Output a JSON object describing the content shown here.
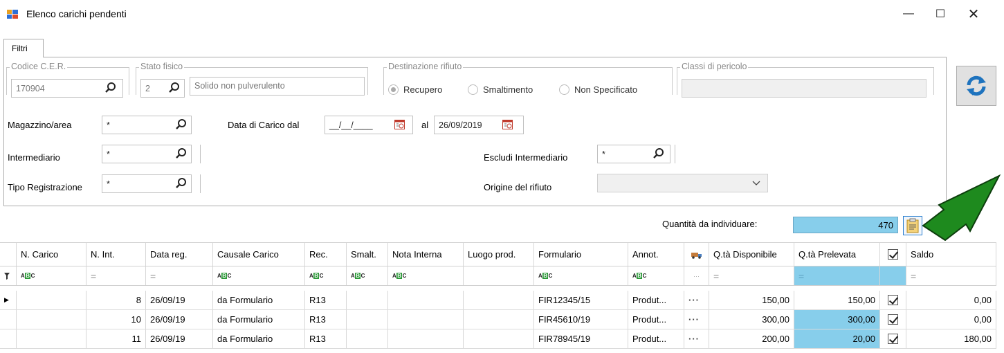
{
  "window": {
    "title": "Elenco carichi pendenti",
    "minimize": "—",
    "maximize": "☐",
    "close": "✕"
  },
  "tabs": [
    {
      "label": "Filtri"
    }
  ],
  "filters": {
    "cer": {
      "legend": "Codice C.E.R.",
      "value": "170904"
    },
    "stato_fisico": {
      "legend": "Stato fisico",
      "code": "2",
      "description": "Solido non pulverulento"
    },
    "destinazione": {
      "legend": "Destinazione rifiuto",
      "options": [
        "Recupero",
        "Smaltimento",
        "Non Specificato"
      ],
      "selected": "Recupero"
    },
    "classi_pericolo": {
      "legend": "Classi di pericolo",
      "value": ""
    },
    "magazzino": {
      "label": "Magazzino/area",
      "value": "*"
    },
    "data_carico": {
      "label": "Data di Carico dal",
      "from": "__/__/____",
      "al_label": "al",
      "to": "26/09/2019"
    },
    "intermediario": {
      "label": "Intermediario",
      "value": "*",
      "description": ""
    },
    "escludi_intermediario": {
      "label": "Escludi Intermediario",
      "value": "*",
      "description": ""
    },
    "tipo_registrazione": {
      "label": "Tipo Registrazione",
      "value": "*",
      "description": ""
    },
    "origine_rifiuto": {
      "label": "Origine del rifiuto",
      "value": ""
    }
  },
  "quantity": {
    "label": "Quantità da individuare:",
    "value": "470"
  },
  "grid": {
    "columns": [
      "N. Carico",
      "N. Int.",
      "Data reg.",
      "Causale Carico",
      "Rec.",
      "Smalt.",
      "Nota Interna",
      "Luogo prod.",
      "Formulario",
      "Annot.",
      "",
      "Q.tà Disponibile",
      "Q.tà Prelevata",
      "",
      "Saldo"
    ],
    "rows": [
      {
        "n_carico": "",
        "n_int": "8",
        "data": "26/09/19",
        "causale": "da Formulario",
        "rec": "R13",
        "smalt": "",
        "nota": "",
        "luogo": "",
        "formulario": "FIR12345/15",
        "annot": "Produt...",
        "more": "···",
        "disponibile": "150,00",
        "prelevata": "150,00",
        "checked": true,
        "saldo": "0,00"
      },
      {
        "n_carico": "",
        "n_int": "10",
        "data": "26/09/19",
        "causale": "da Formulario",
        "rec": "R13",
        "smalt": "",
        "nota": "",
        "luogo": "",
        "formulario": "FIR45610/19",
        "annot": "Produt...",
        "more": "···",
        "disponibile": "300,00",
        "prelevata": "300,00",
        "checked": true,
        "saldo": "0,00"
      },
      {
        "n_carico": "",
        "n_int": "11",
        "data": "26/09/19",
        "causale": "da Formulario",
        "rec": "R13",
        "smalt": "",
        "nota": "",
        "luogo": "",
        "formulario": "FIR78945/19",
        "annot": "Produt...",
        "more": "···",
        "disponibile": "200,00",
        "prelevata": "20,00",
        "checked": true,
        "saldo": "180,00"
      }
    ]
  },
  "colors": {
    "highlight": "#87ceeb",
    "arrow": "#1e8a1e",
    "refresh": "#1e73be"
  }
}
